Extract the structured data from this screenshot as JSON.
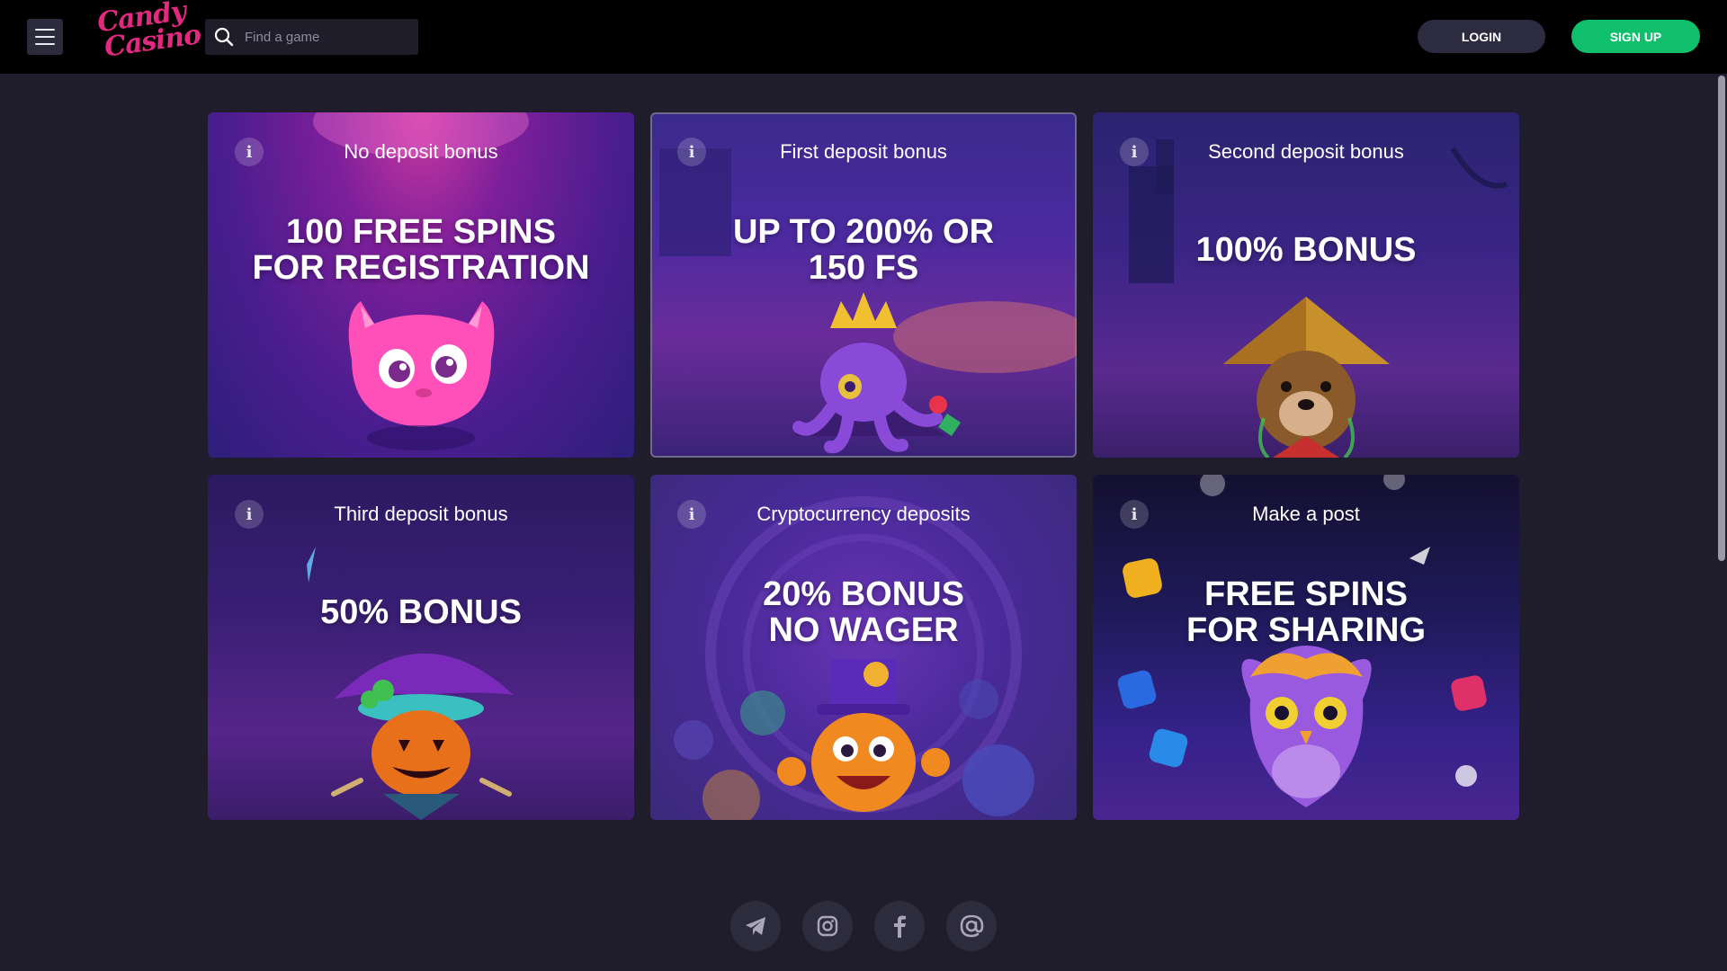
{
  "header": {
    "logo_line1": "Candy",
    "logo_line2": "Casino",
    "search_placeholder": "Find a game",
    "login_label": "LOGIN",
    "signup_label": "SIGN UP"
  },
  "colors": {
    "background": "#1f1d2c",
    "topbar": "#000000",
    "signup": "#0fbf6b",
    "login": "#2c2b3f",
    "logo": "#e3287f"
  },
  "bonuses": [
    {
      "label": "No deposit bonus",
      "headline_line1": "100 FREE SPINS",
      "headline_line2": "FOR REGISTRATION",
      "art": "pink-cat"
    },
    {
      "label": "First deposit bonus",
      "headline_line1": "UP TO 200% OR",
      "headline_line2": "150 FS",
      "art": "octopus-king"
    },
    {
      "label": "Second deposit bonus",
      "headline_line1": "100% BONUS",
      "headline_line2": "",
      "art": "dog-warrior"
    },
    {
      "label": "Third deposit bonus",
      "headline_line1": "50% BONUS",
      "headline_line2": "",
      "art": "pumpkin-witch"
    },
    {
      "label": "Cryptocurrency deposits",
      "headline_line1": "20% BONUS",
      "headline_line2": "NO WAGER",
      "art": "orange-magician"
    },
    {
      "label": "Make a post",
      "headline_line1": "FREE SPINS",
      "headline_line2": "FOR SHARING",
      "art": "purple-owl"
    }
  ],
  "info_glyph": "i",
  "social": [
    {
      "icon": "telegram-icon"
    },
    {
      "icon": "instagram-icon"
    },
    {
      "icon": "facebook-icon"
    },
    {
      "icon": "email-icon"
    }
  ]
}
